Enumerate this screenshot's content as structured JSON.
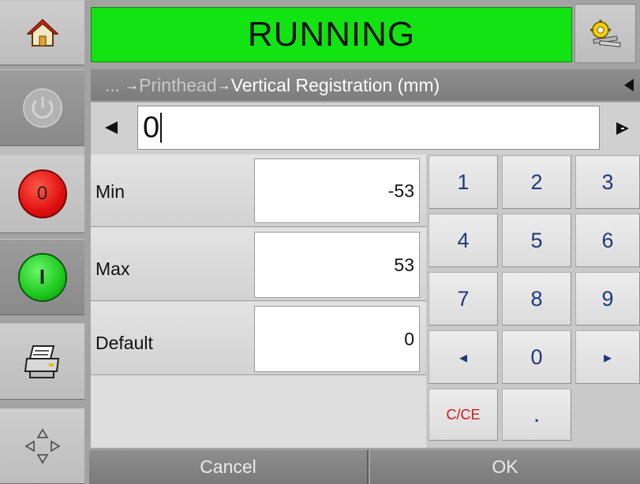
{
  "status": {
    "text": "RUNNING",
    "color": "#0fe00f"
  },
  "header": {
    "home_icon": "home-icon",
    "tools_icon": "tools-icon"
  },
  "sidebar": {
    "items": [
      {
        "name": "power-button",
        "icon": "power-icon"
      },
      {
        "name": "stop-button",
        "label": "0",
        "color": "#e01010"
      },
      {
        "name": "start-button",
        "label": "I",
        "color": "#1ec81e"
      },
      {
        "name": "printer-button",
        "icon": "printer-icon"
      },
      {
        "name": "navigate-button",
        "icon": "move-arrows-icon"
      }
    ]
  },
  "breadcrumb": {
    "ellipsis": "...",
    "arrow": "→",
    "parent": "Printhead",
    "current": "Vertical Registration (mm)"
  },
  "input": {
    "value": "0"
  },
  "fields": [
    {
      "label": "Min",
      "value": "-53"
    },
    {
      "label": "Max",
      "value": "53"
    },
    {
      "label": "Default",
      "value": "0"
    }
  ],
  "keypad": {
    "keys": [
      "1",
      "2",
      "3",
      "4",
      "5",
      "6",
      "7",
      "8",
      "9",
      "◂",
      "0",
      "▸",
      "C/CE",
      "."
    ]
  },
  "footer": {
    "cancel_label": "Cancel",
    "ok_label": "OK"
  }
}
